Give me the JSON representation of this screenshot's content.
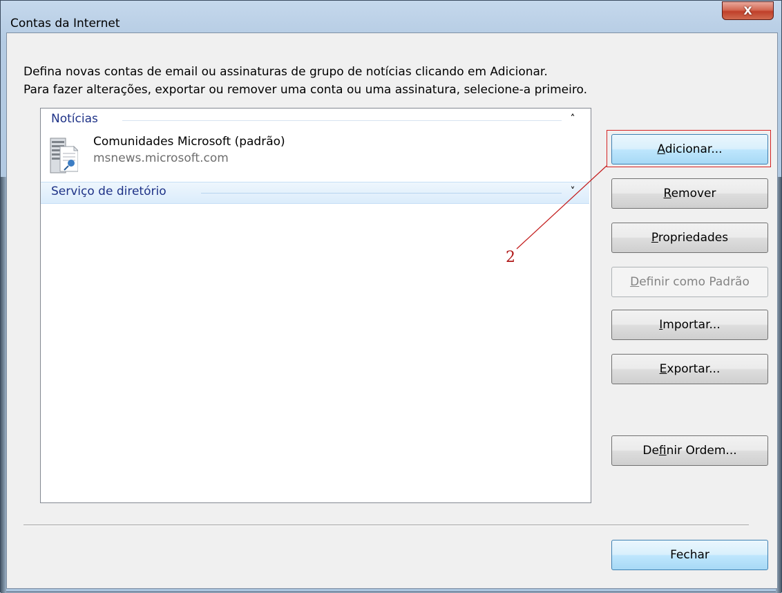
{
  "window": {
    "title": "Contas da Internet",
    "close_label": "X"
  },
  "description": {
    "line1": "Defina novas contas de email ou assinaturas de grupo de notícias clicando em Adicionar.",
    "line2": "Para fazer alterações, exportar ou remover uma conta ou uma assinatura, selecione-a primeiro."
  },
  "accounts": {
    "groups": [
      {
        "title": "Notícias",
        "expanded": true,
        "items": [
          {
            "name": "Comunidades Microsoft (padrão)",
            "server": "msnews.microsoft.com",
            "icon": "news-server-icon"
          }
        ]
      },
      {
        "title": "Serviço de diretório",
        "expanded": false,
        "items": []
      }
    ]
  },
  "buttons": {
    "add": {
      "accel": "A",
      "rest": "dicionar..."
    },
    "remove": {
      "accel": "R",
      "rest": "emover"
    },
    "properties": {
      "accel": "P",
      "rest": "ropriedades"
    },
    "set_default": {
      "accel": "D",
      "rest": "efinir como Padrão",
      "disabled": true
    },
    "import": {
      "accel": "I",
      "rest": "mportar..."
    },
    "export": {
      "accel": "E",
      "rest": "xportar..."
    },
    "set_order": {
      "pre": "De",
      "accel": "f",
      "rest": "inir Ordem..."
    },
    "close": "Fechar"
  },
  "annotation": {
    "step_number": "2",
    "color": "#b01818"
  },
  "colors": {
    "group_header_text": "#1e3287",
    "default_button_border": "#3c7fb1",
    "close_button": "#c0402a"
  }
}
